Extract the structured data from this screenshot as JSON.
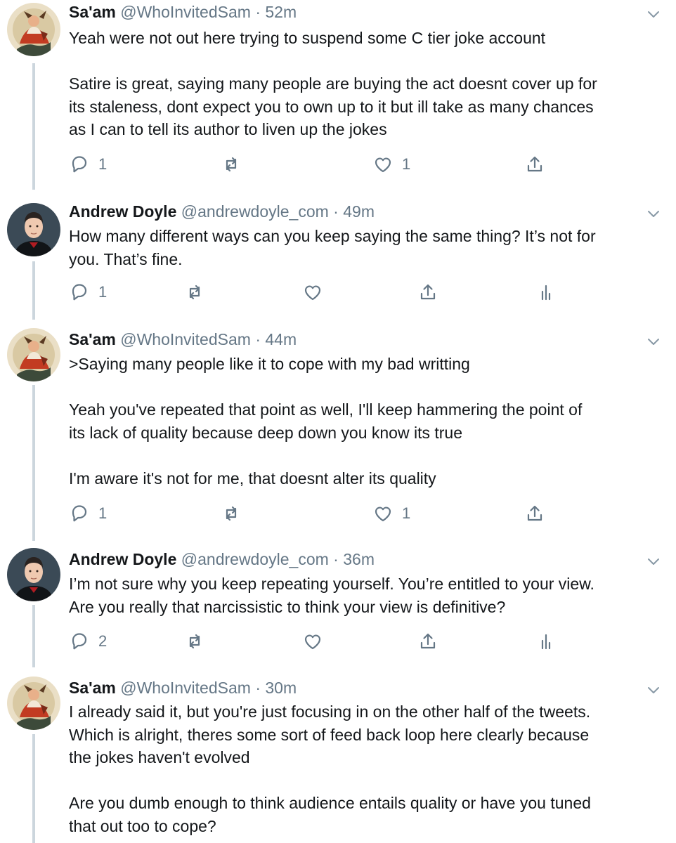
{
  "tweets": [
    {
      "name": "Sa'am",
      "handle": "@WhoInvitedSam",
      "sep": "·",
      "time": "52m",
      "avatar": "sam-avatar",
      "paragraphs": [
        [
          "Yeah were not out here trying to suspend some C tier joke account"
        ],
        [
          "Satire is great, saying many people are buying the act doesnt cover up for",
          "its staleness, dont expect you to own up to it but ill take as many chances",
          "as I can to tell its author to liven up the jokes"
        ]
      ],
      "reply_count": "1",
      "retweet_count": "",
      "like_count": "1",
      "has_analytics": false
    },
    {
      "name": "Andrew Doyle",
      "handle": "@andrewdoyle_com",
      "sep": "·",
      "time": "49m",
      "avatar": "andrew-avatar",
      "paragraphs": [
        [
          "How many different ways can you keep saying the same thing? It’s not for",
          "you. That’s fine."
        ]
      ],
      "reply_count": "1",
      "retweet_count": "",
      "like_count": "",
      "has_analytics": true
    },
    {
      "name": "Sa'am",
      "handle": "@WhoInvitedSam",
      "sep": "·",
      "time": "44m",
      "avatar": "sam-avatar",
      "paragraphs": [
        [
          ">Saying many people like it to cope with my bad writting"
        ],
        [
          "Yeah you've repeated that point as well, I'll keep hammering the point of",
          "its lack of quality because deep down you know its true"
        ],
        [
          "I'm aware it's not for me, that doesnt alter its quality"
        ]
      ],
      "reply_count": "1",
      "retweet_count": "",
      "like_count": "1",
      "has_analytics": false
    },
    {
      "name": "Andrew Doyle",
      "handle": "@andrewdoyle_com",
      "sep": "·",
      "time": "36m",
      "avatar": "andrew-avatar",
      "paragraphs": [
        [
          "I’m not sure why you keep repeating yourself. You’re entitled to your view.",
          "Are you really that narcissistic to think your view is definitive?"
        ]
      ],
      "reply_count": "2",
      "retweet_count": "",
      "like_count": "",
      "has_analytics": true
    },
    {
      "name": "Sa'am",
      "handle": "@WhoInvitedSam",
      "sep": "·",
      "time": "30m",
      "avatar": "sam-avatar",
      "paragraphs": [
        [
          "I already said it, but you're just focusing in on the other half of the tweets.",
          "Which is alright, theres some sort of feed back loop here clearly because",
          "the jokes haven't evolved"
        ],
        [
          "Are you dumb enough to think audience entails quality or have you tuned",
          "that out too to cope?"
        ]
      ],
      "reply_count": "",
      "retweet_count": "",
      "like_count": "",
      "has_analytics": false
    }
  ],
  "icons": {
    "reply": "reply-icon",
    "retweet": "retweet-icon",
    "like": "heart-icon",
    "share": "share-icon",
    "analytics": "analytics-icon",
    "caret": "chevron-down-icon"
  },
  "colors": {
    "text": "#14171a",
    "secondary": "#657786",
    "thread_line": "#ccd6dd",
    "background": "#ffffff"
  }
}
